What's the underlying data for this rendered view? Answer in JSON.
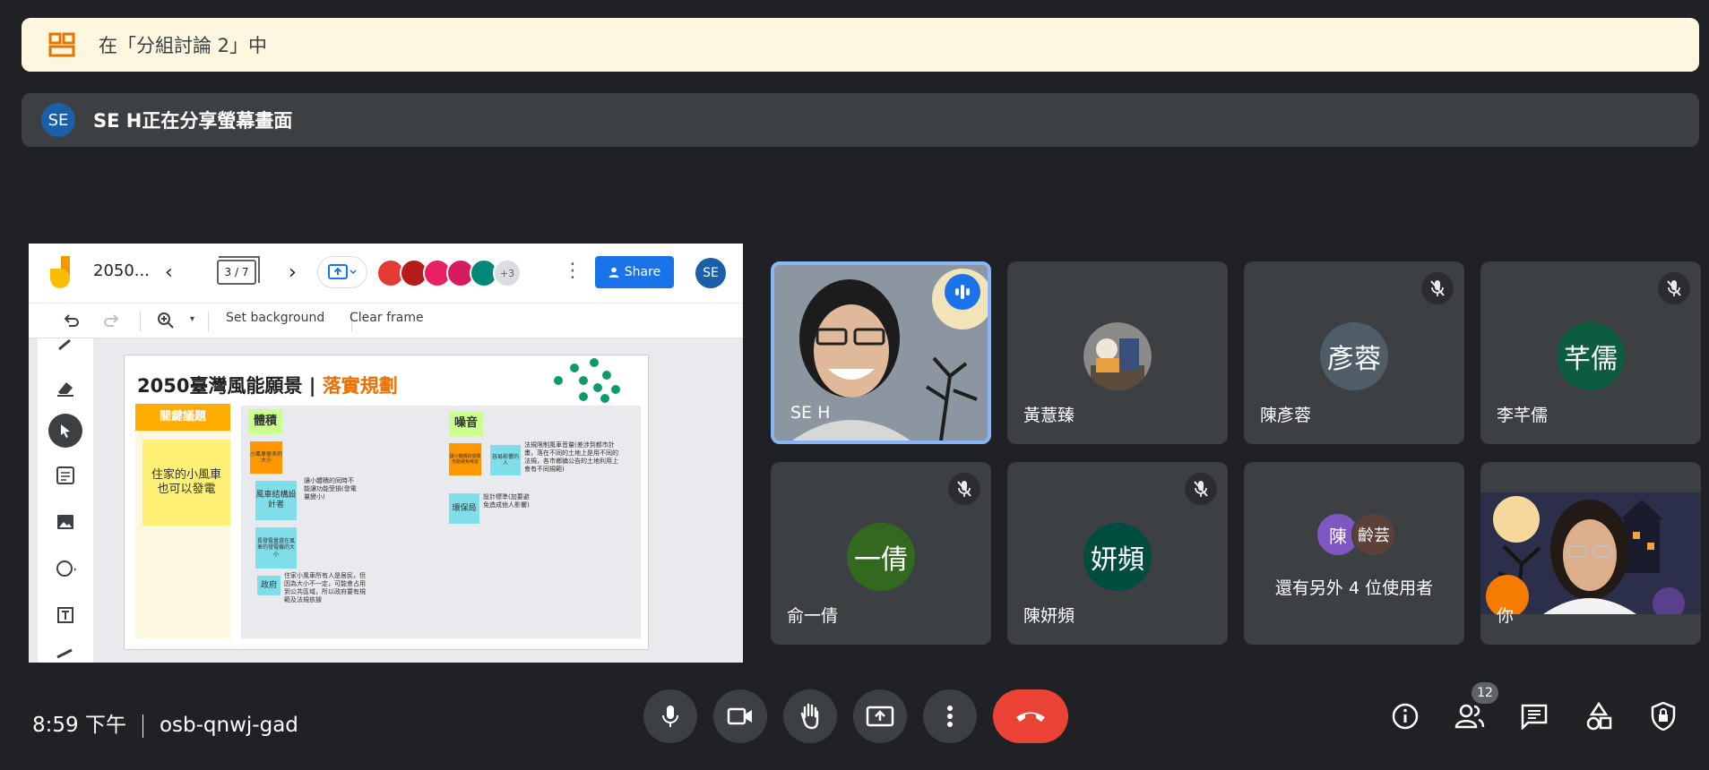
{
  "banners": {
    "breakout_text": "在「分組討論 2」中",
    "presenter_initials": "SE",
    "sharing_text": "SE H正在分享螢幕畫面"
  },
  "jamboard": {
    "title": "2050...",
    "page_indicator": "3 / 7",
    "collaborators_more": "+3",
    "share_label": "Share",
    "user_initials": "SE",
    "toolbar": {
      "set_background": "Set background",
      "clear_frame": "Clear frame"
    },
    "slide": {
      "title_main": "2050臺灣風能願景 | ",
      "title_highlight": "落實規劃",
      "key_issue_label": "關鍵議題",
      "key_issue_note": "住家的小風車也可以發電",
      "volume_label": "體積",
      "volume_small": "小風車很多的大小",
      "designer_note": "風車結構設計者",
      "designer_text": "讓小體積的同時不能讓功能受損(發電量變小)",
      "size_note": "長發電量還在風車的發電機的大小",
      "gov_note": "政府",
      "gov_text": "住家小風車所有人是居民，但因為大小不一定，可能會占用到公共區域，所以政府要有規範及法規依據",
      "noise_label": "噪音",
      "noise_small": "讓小體積的發電也能避免噪音",
      "resident_note": "容易影響的人",
      "resident_text": "法規限制風車音量(差涉到都市計畫，落在不同的土地上是用不同的法規，各市鄉鎮公告的土地利用上會有不同規範)",
      "epa_note": "環保局",
      "epa_text": "設計標準(加要避免造成他人影響)"
    }
  },
  "participants": [
    {
      "name": "SE H",
      "type": "video",
      "speaking": true
    },
    {
      "name": "黃薏臻",
      "type": "avatar-image"
    },
    {
      "name": "陳彥蓉",
      "initials": "彥蓉",
      "color": "#4e5d67",
      "muted": true
    },
    {
      "name": "李芊儒",
      "initials": "芊儒",
      "color": "#0d5c3f",
      "muted": true
    },
    {
      "name": "俞一倩",
      "initials": "一倩",
      "color": "#33691e",
      "muted": true
    },
    {
      "name": "陳妍頻",
      "initials": "妍頻",
      "color": "#004d40",
      "muted": true
    },
    {
      "name": "還有另外 4 位使用者",
      "initials_a": "陳",
      "initials_b": "齡芸"
    },
    {
      "name": "你",
      "type": "video"
    }
  ],
  "bottom_bar": {
    "time": "8:59 下午",
    "meeting_code": "osb-qnwj-gad",
    "people_count": "12"
  },
  "colors": {
    "background": "#202124",
    "tile": "#3c4043",
    "end_call": "#ea4335",
    "accent": "#8ab4f8",
    "banner_yellow": "#fef7e0"
  }
}
